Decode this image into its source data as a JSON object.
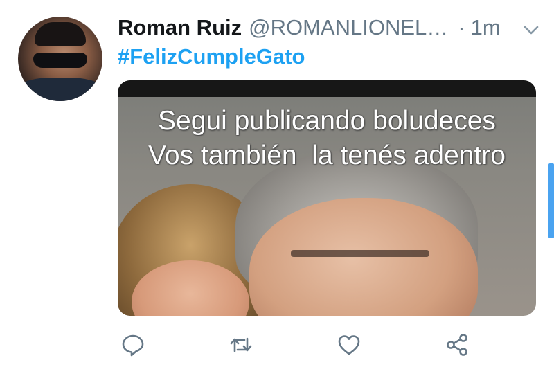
{
  "tweet": {
    "author_name": "Roman Ruiz",
    "author_handle": "@ROMANLIONEL…",
    "separator": "·",
    "timestamp": "1m",
    "hashtag": "#FelizCumpleGato",
    "media": {
      "caption_line1": "Segui publicando boludeces",
      "caption_line2": "Vos también  la tenés adentro"
    }
  },
  "icons": {
    "menu": "chevron-down-icon",
    "reply": "reply-icon",
    "retweet": "retweet-icon",
    "like": "heart-icon",
    "share": "share-icon"
  },
  "colors": {
    "link": "#1da1f2",
    "secondary_text": "#657786",
    "primary_text": "#14171a",
    "scrollbar": "#4aa3f0"
  }
}
